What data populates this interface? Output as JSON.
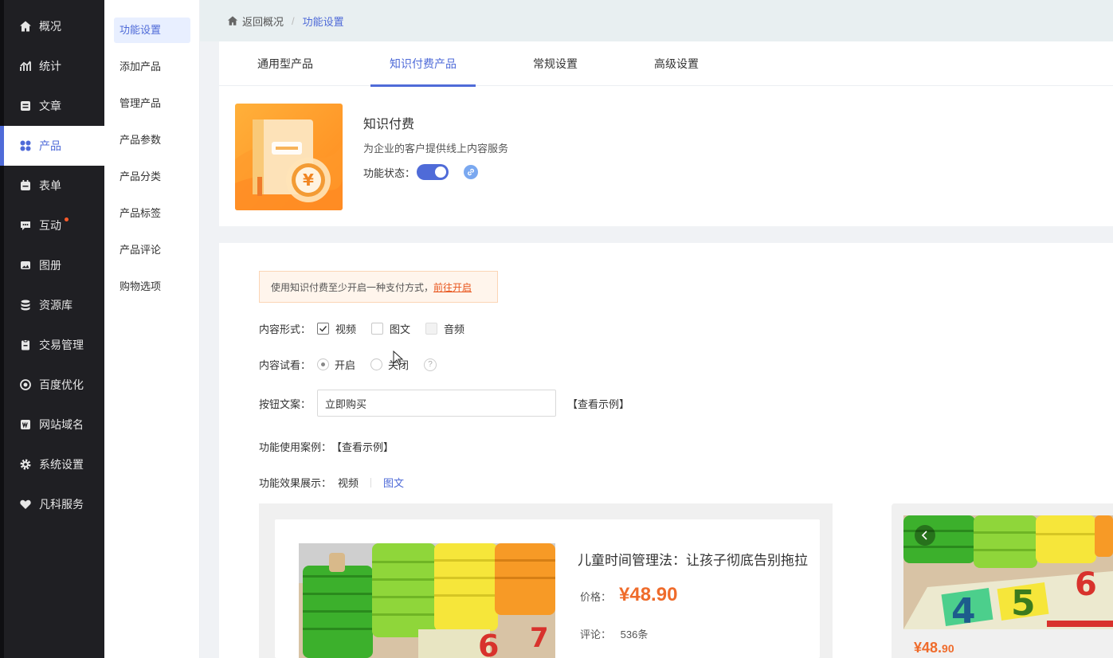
{
  "sidebar": {
    "items": [
      {
        "label": "概况",
        "icon": "home-icon"
      },
      {
        "label": "统计",
        "icon": "chart-icon"
      },
      {
        "label": "文章",
        "icon": "article-icon"
      },
      {
        "label": "产品",
        "icon": "grid-icon"
      },
      {
        "label": "表单",
        "icon": "calendar-icon"
      },
      {
        "label": "互动",
        "icon": "chat-icon"
      },
      {
        "label": "图册",
        "icon": "image-icon"
      },
      {
        "label": "资源库",
        "icon": "database-icon"
      },
      {
        "label": "交易管理",
        "icon": "clipboard-icon"
      },
      {
        "label": "百度优化",
        "icon": "target-icon"
      },
      {
        "label": "网站域名",
        "icon": "w-icon"
      },
      {
        "label": "系统设置",
        "icon": "gear-icon"
      },
      {
        "label": "凡科服务",
        "icon": "heart-icon"
      }
    ],
    "active_label": "产品"
  },
  "submenu": {
    "items": [
      "功能设置",
      "添加产品",
      "管理产品",
      "产品参数",
      "产品分类",
      "产品标签",
      "产品评论",
      "购物选项"
    ],
    "active": "功能设置"
  },
  "breadcrumb": {
    "home": "返回概况",
    "separator": "/",
    "current": "功能设置"
  },
  "tabs": [
    "通用型产品",
    "知识付费产品",
    "常规设置",
    "高级设置"
  ],
  "active_tab": "知识付费产品",
  "feature": {
    "title": "知识付费",
    "description": "为企业的客户提供线上内容服务",
    "status_label": "功能状态：",
    "enabled": true
  },
  "form": {
    "notice_text": "使用知识付费至少开启一种支付方式，",
    "notice_link": "前往开启",
    "content_type_label": "内容形式：",
    "content_types": [
      {
        "label": "视频",
        "checked": true
      },
      {
        "label": "图文",
        "checked": false
      },
      {
        "label": "音频",
        "checked": false
      }
    ],
    "preview_label": "内容试看：",
    "preview_options": [
      {
        "label": "开启",
        "selected": true
      },
      {
        "label": "关闭",
        "selected": false
      }
    ],
    "help": "?",
    "button_text_label": "按钮文案：",
    "button_text_value": "立即购买",
    "view_example": "【查看示例】",
    "use_case_label": "功能使用案例：",
    "use_case_link": "【查看示例】",
    "effect_label": "功能效果展示：",
    "effect_tabs": [
      "视频",
      "图文"
    ],
    "effect_active": "图文"
  },
  "demo_card": {
    "title": "儿童时间管理法：让孩子彻底告别拖拉",
    "price_label": "价格：",
    "price": "¥48.90",
    "reviews_label": "评论：",
    "reviews": "536条"
  },
  "demo_card2": {
    "price_main": "¥48.",
    "price_cents": "90"
  },
  "colors": {
    "accent": "#4f6bd8",
    "price": "#ef6b2b",
    "sidebar_bg": "#1f1f23"
  }
}
